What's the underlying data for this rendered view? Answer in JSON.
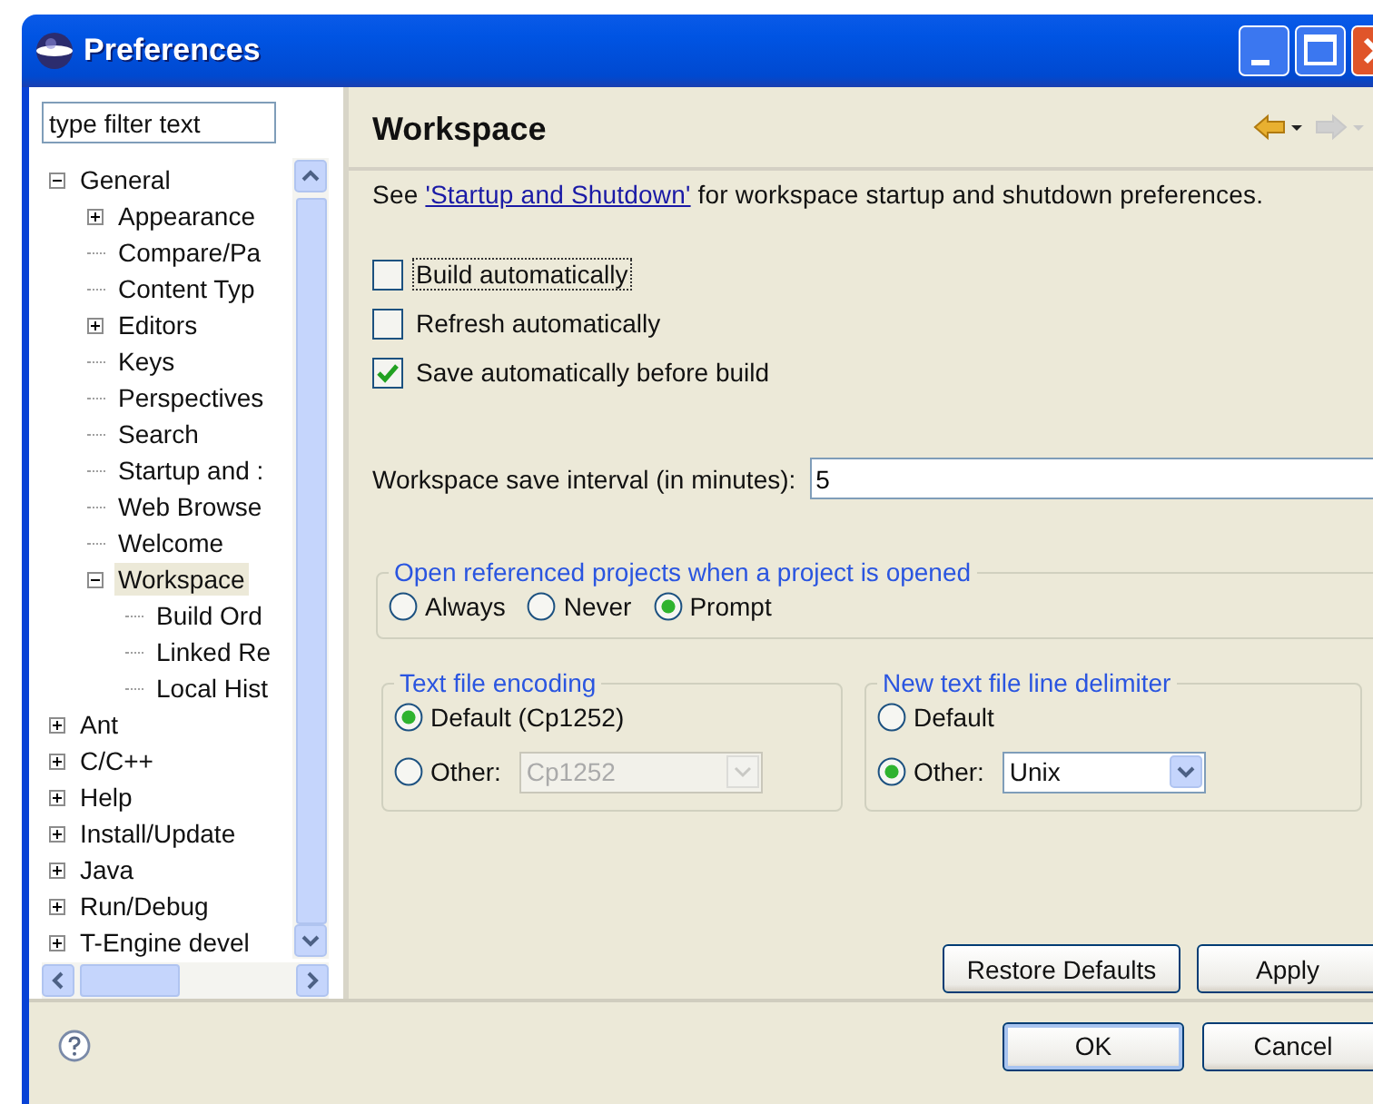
{
  "window": {
    "title": "Preferences"
  },
  "filter": {
    "placeholder": "type filter text"
  },
  "tree": [
    {
      "label": "General",
      "kind": "branch",
      "expanded": true,
      "selected": false,
      "children": [
        {
          "label": "Appearance",
          "kind": "branch",
          "expanded": false,
          "selected": false
        },
        {
          "label": "Compare/Pa",
          "kind": "leaf",
          "selected": false
        },
        {
          "label": "Content Typ",
          "kind": "leaf",
          "selected": false
        },
        {
          "label": "Editors",
          "kind": "branch",
          "expanded": false,
          "selected": false
        },
        {
          "label": "Keys",
          "kind": "leaf",
          "selected": false
        },
        {
          "label": "Perspectives",
          "kind": "leaf",
          "selected": false
        },
        {
          "label": "Search",
          "kind": "leaf",
          "selected": false
        },
        {
          "label": "Startup and :",
          "kind": "leaf",
          "selected": false
        },
        {
          "label": "Web Browse",
          "kind": "leaf",
          "selected": false
        },
        {
          "label": "Welcome",
          "kind": "leaf",
          "selected": false
        },
        {
          "label": "Workspace",
          "kind": "branch",
          "expanded": true,
          "selected": true,
          "children": [
            {
              "label": "Build Ord",
              "kind": "leaf",
              "selected": false
            },
            {
              "label": "Linked Re",
              "kind": "leaf",
              "selected": false
            },
            {
              "label": "Local Hist",
              "kind": "leaf",
              "selected": false
            }
          ]
        }
      ]
    },
    {
      "label": "Ant",
      "kind": "branch",
      "expanded": false,
      "selected": false
    },
    {
      "label": "C/C++",
      "kind": "branch",
      "expanded": false,
      "selected": false
    },
    {
      "label": "Help",
      "kind": "branch",
      "expanded": false,
      "selected": false
    },
    {
      "label": "Install/Update",
      "kind": "branch",
      "expanded": false,
      "selected": false
    },
    {
      "label": "Java",
      "kind": "branch",
      "expanded": false,
      "selected": false
    },
    {
      "label": "Run/Debug",
      "kind": "branch",
      "expanded": false,
      "selected": false
    },
    {
      "label": "T-Engine devel",
      "kind": "branch",
      "expanded": false,
      "selected": false
    }
  ],
  "page": {
    "title": "Workspace",
    "nav": [
      {
        "kind": "back",
        "disabled": false
      },
      {
        "kind": "forward",
        "disabled": true
      }
    ],
    "intro": {
      "before": "See",
      "link": "'Startup and Shutdown'",
      "after": "for workspace startup and shutdown preferences."
    },
    "checkboxes": [
      {
        "label": "Build automatically",
        "checked": false,
        "focused": true
      },
      {
        "label": "Refresh automatically",
        "checked": false,
        "focused": false
      },
      {
        "label": "Save automatically before build",
        "checked": true,
        "focused": false
      }
    ],
    "interval": {
      "label": "Workspace save interval (in minutes):",
      "value": "5"
    },
    "open_projects": {
      "title": "Open referenced projects when a project is opened",
      "options": [
        {
          "label": "Always",
          "selected": false
        },
        {
          "label": "Never",
          "selected": false
        },
        {
          "label": "Prompt",
          "selected": true
        }
      ]
    },
    "encoding": {
      "title": "Text file encoding",
      "options": [
        {
          "label": "Default (Cp1252)",
          "selected": true
        },
        {
          "label": "Other:",
          "selected": false,
          "combo": {
            "value": "Cp1252",
            "disabled": true
          }
        }
      ]
    },
    "delimiter": {
      "title": "New text file line delimiter",
      "options": [
        {
          "label": "Default",
          "selected": false
        },
        {
          "label": "Other:",
          "selected": true,
          "combo": {
            "value": "Unix",
            "disabled": false
          }
        }
      ]
    },
    "buttons": [
      "Restore Defaults",
      "Apply"
    ]
  },
  "footer": {
    "buttons": [
      {
        "label": "OK",
        "default": true
      },
      {
        "label": "Cancel",
        "default": false
      }
    ]
  }
}
